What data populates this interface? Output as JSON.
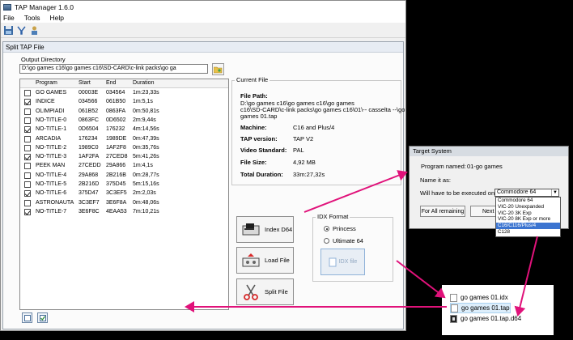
{
  "app": {
    "title": "TAP Manager 1.6.0"
  },
  "menu": [
    "File",
    "Tools",
    "Help"
  ],
  "toolbar": {
    "icons": [
      "save-tap-icon",
      "tools-icon",
      "person-icon"
    ]
  },
  "panel": {
    "title": "Split TAP File"
  },
  "output": {
    "label": "Output Directory",
    "path": "D:\\go games c16\\go games c16\\SD-CARD\\c-link packs\\go ga",
    "button_icon": "open-folder-icon"
  },
  "list": {
    "headers": [
      "Program",
      "Start",
      "End",
      "Duration"
    ],
    "rows": [
      {
        "checked": false,
        "program": "GO GAMES",
        "start": "00003E",
        "end": "034564",
        "duration": "1m:23,33s"
      },
      {
        "checked": true,
        "program": "INDICE",
        "start": "034566",
        "end": "061B50",
        "duration": "1m:5,1s"
      },
      {
        "checked": false,
        "program": "OLIMPIADI",
        "start": "061B52",
        "end": "0863FA",
        "duration": "0m:50,81s"
      },
      {
        "checked": false,
        "program": "NO-TITLE-0",
        "start": "0863FC",
        "end": "0D6502",
        "duration": "2m:9,44s"
      },
      {
        "checked": true,
        "program": "NO-TITLE-1",
        "start": "0D6504",
        "end": "176232",
        "duration": "4m:14,56s"
      },
      {
        "checked": false,
        "program": "ARCADIA",
        "start": "176234",
        "end": "1989DE",
        "duration": "0m:47,39s"
      },
      {
        "checked": false,
        "program": "NO-TITLE-2",
        "start": "1989C0",
        "end": "1AF2F8",
        "duration": "0m:35,76s"
      },
      {
        "checked": true,
        "program": "NO-TITLE-3",
        "start": "1AF2FA",
        "end": "27CED8",
        "duration": "5m:41,26s"
      },
      {
        "checked": false,
        "program": "PEEK MAN",
        "start": "27CEDD",
        "end": "29A866",
        "duration": "1m:4,1s"
      },
      {
        "checked": false,
        "program": "NO-TITLE-4",
        "start": "29A868",
        "end": "2B216B",
        "duration": "0m:28,77s"
      },
      {
        "checked": false,
        "program": "NO-TITLE-5",
        "start": "2B216D",
        "end": "375D45",
        "duration": "5m:15,16s"
      },
      {
        "checked": true,
        "program": "NO-TITLE-6",
        "start": "375D47",
        "end": "3C3EF5",
        "duration": "2m:2,03s"
      },
      {
        "checked": false,
        "program": "ASTRONAUTA",
        "start": "3C3EF7",
        "end": "3E6F8A",
        "duration": "0m:48,06s"
      },
      {
        "checked": true,
        "program": "NO-TITLE-7",
        "start": "3E6F8C",
        "end": "4EAA53",
        "duration": "7m:10,21s"
      }
    ]
  },
  "current_file": {
    "title": "Current File",
    "file_path_label": "File Path:",
    "file_path_lines": [
      "D:\\go games c16\\go games c16\\go games",
      "c16\\SD-CARD\\c-link packs\\go games c16\\01\\-- casselta --\\go",
      "games 01.tap"
    ],
    "fields": [
      {
        "label": "Machine:",
        "value": "C16 and Plus/4"
      },
      {
        "label": "TAP version:",
        "value": "TAP V2"
      },
      {
        "label": "Video Standard:",
        "value": "PAL"
      },
      {
        "label": "File Size:",
        "value": "4,92 MB"
      },
      {
        "label": "Total Duration:",
        "value": "33m:27,32s"
      }
    ]
  },
  "buttons": {
    "index_d64": "Index D64",
    "load_file": "Load File",
    "split_file": "Split File",
    "idx_file": "IDX file"
  },
  "idx_format": {
    "title": "IDX Format",
    "options": [
      {
        "label": "Princess",
        "selected": true
      },
      {
        "label": "Ultimate 64",
        "selected": false
      }
    ]
  },
  "target_dialog": {
    "title": "Target System",
    "program_named_label": "Program named:",
    "program_named_value": "01-go games",
    "name_it_as_label": "Name it as:",
    "name_it_as_value": "GO GAMES",
    "executed_label": "Will have to be executed on a:",
    "selected_value": "Commodore 64",
    "for_all_label": "For All remaining",
    "next_label": "Next",
    "options": [
      "Commodore 64",
      "VIC-20 Unexpanded",
      "VIC-20 3K Exp",
      "VIC-20 8K Exp or more",
      "C16/C116/Plus/4",
      "C128"
    ],
    "highlighted_option": "C16/C116/Plus/4"
  },
  "explorer": {
    "files": [
      {
        "name": "go games 01.idx",
        "icon": "text-file-icon"
      },
      {
        "name": "go games 01.tap",
        "icon": "tap-file-icon"
      },
      {
        "name": "go games 01.tap.d64",
        "icon": "disk-image-icon"
      }
    ]
  },
  "colors": {
    "arrow": "#e0127a",
    "selection": "#3b74d0"
  }
}
